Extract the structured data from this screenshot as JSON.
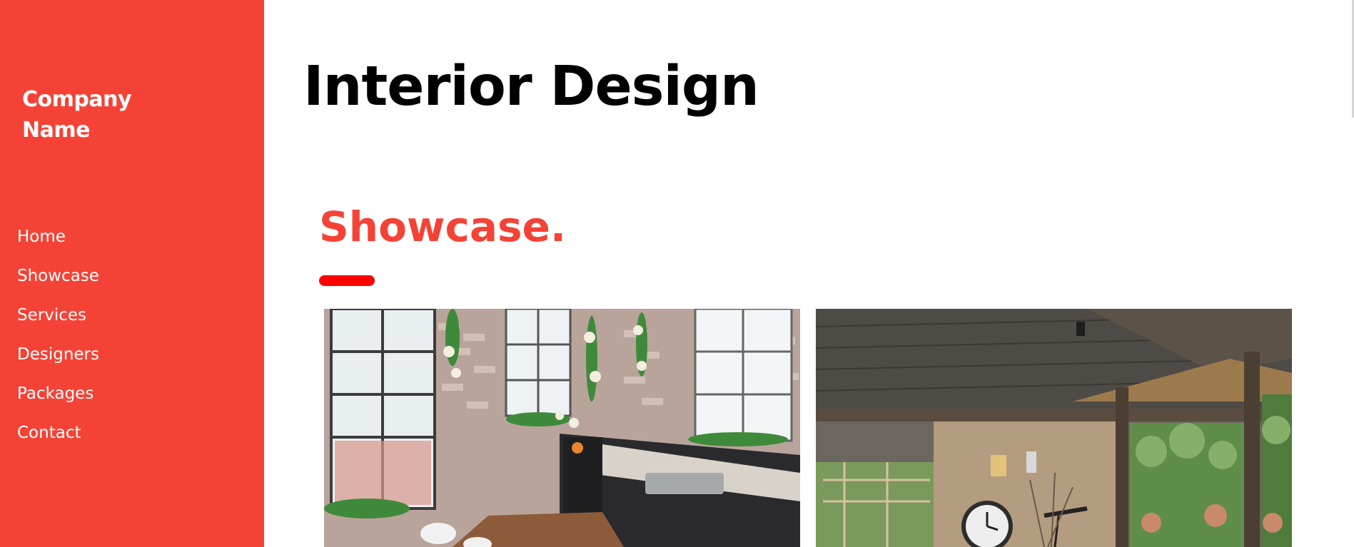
{
  "sidebar": {
    "brand": "Company Name",
    "items": [
      {
        "label": "Home"
      },
      {
        "label": "Showcase"
      },
      {
        "label": "Services"
      },
      {
        "label": "Designers"
      },
      {
        "label": "Packages"
      },
      {
        "label": "Contact"
      }
    ]
  },
  "main": {
    "title": "Interior Design",
    "section_title": "Showcase.",
    "gallery": [
      {
        "subject": "kitchen-with-brick-walls-and-windows"
      },
      {
        "subject": "covered-patio-with-wall-clock-and-garden-view"
      }
    ]
  },
  "colors": {
    "accent": "#f44336",
    "underline": "#ff0000",
    "sidebar_text": "#ffffff",
    "title_text": "#000000"
  }
}
